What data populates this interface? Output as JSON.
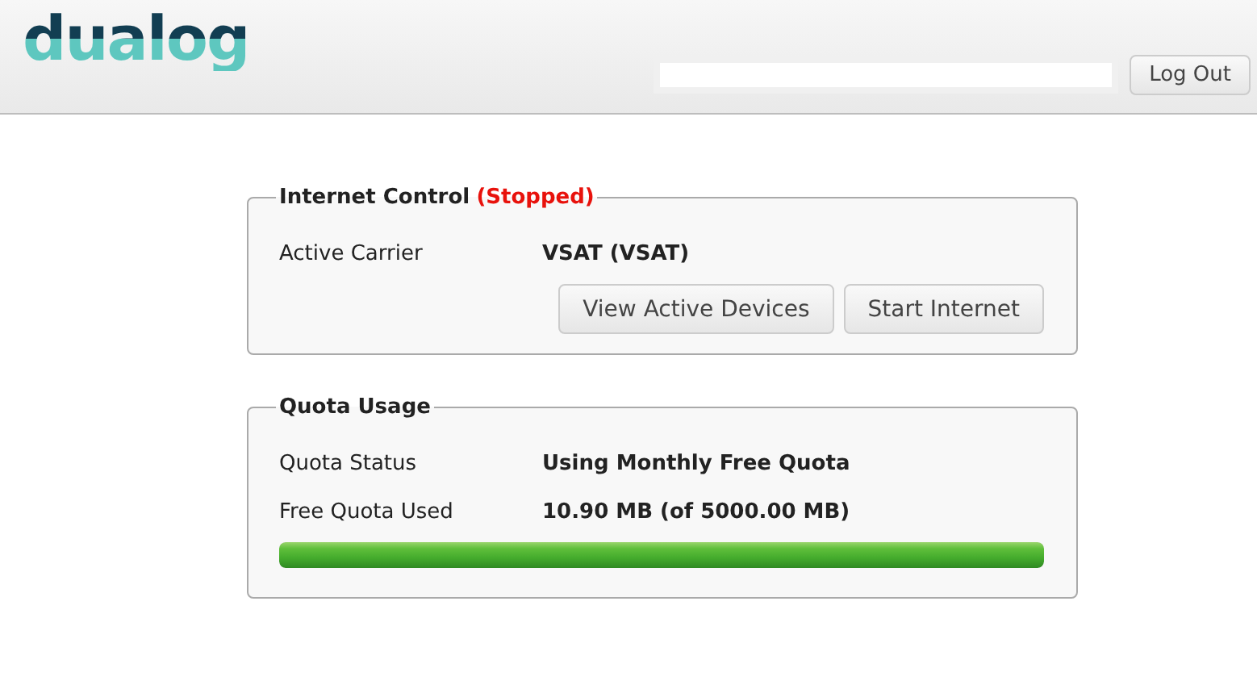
{
  "header": {
    "logo": "dualog",
    "logout_button": "Log Out"
  },
  "internet_control": {
    "title": "Internet Control",
    "status": "(Stopped)",
    "rows": [
      {
        "label": "Active Carrier",
        "value": "VSAT (VSAT)"
      }
    ],
    "buttons": [
      "View Active Devices",
      "Start Internet"
    ]
  },
  "quota_usage": {
    "title": "Quota Usage",
    "rows": [
      {
        "label": "Quota Status",
        "value": "Using Monthly Free Quota"
      },
      {
        "label": "Free Quota Used",
        "value": "10.90 MB (of 5000.00 MB)"
      }
    ],
    "bar": {
      "level": 1
    }
  }
}
